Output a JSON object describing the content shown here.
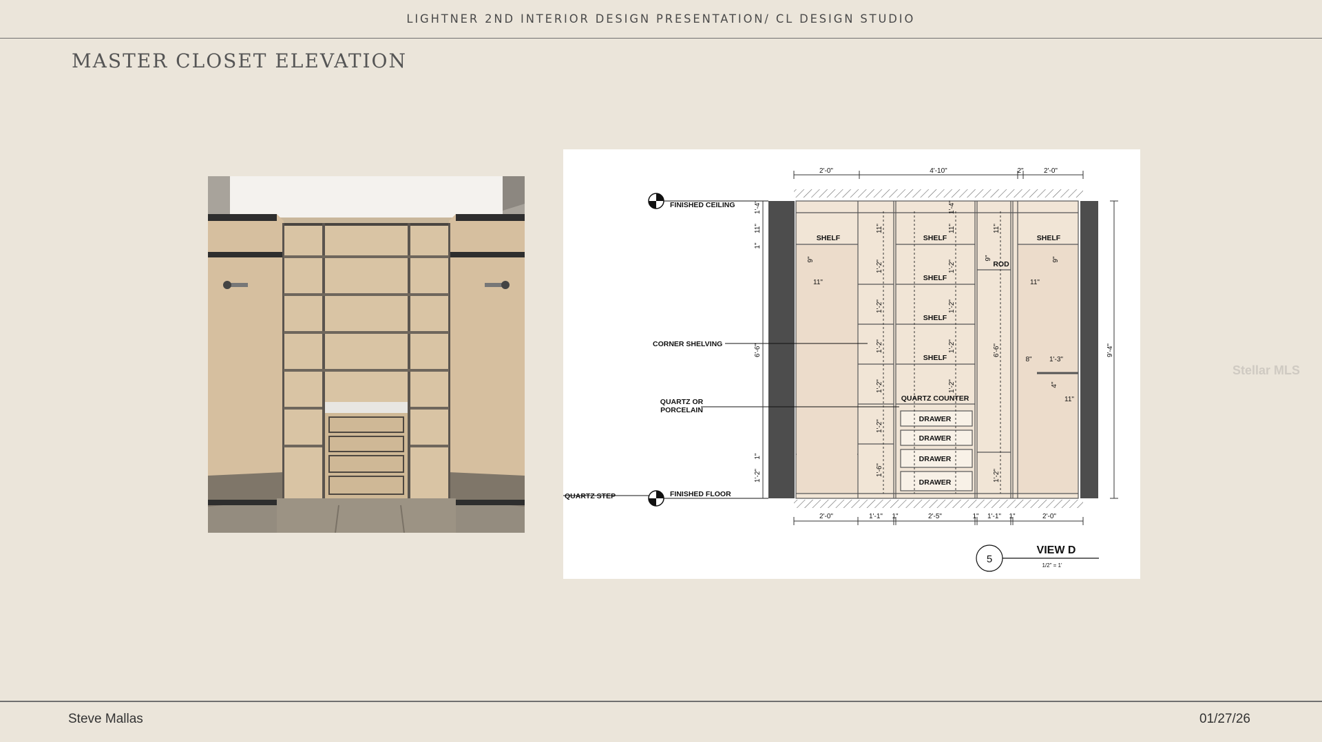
{
  "header": {
    "title": "LIGHTNER 2ND INTERIOR DESIGN PRESENTATION/ CL DESIGN STUDIO"
  },
  "page": {
    "title": "MASTER CLOSET ELEVATION"
  },
  "footer": {
    "author": "Steve Mallas",
    "date": "01/27/26"
  },
  "watermark": "Stellar MLS",
  "drawing": {
    "labels": {
      "finished_ceiling": "FINISHED CEILING",
      "finished_floor": "FINISHED FLOOR",
      "corner_shelving": "CORNER SHELVING",
      "quartz_or": "QUARTZ OR",
      "porcelain": "PORCELAIN",
      "quartz_step": "QUARTZ STEP",
      "quartz_counter": "QUARTZ COUNTER",
      "shelf": "SHELF",
      "rod": "ROD",
      "drawer": "DRAWER",
      "view_number": "5",
      "view_title": "VIEW D",
      "view_scale": "1/2\" = 1'"
    },
    "top_dims": [
      "2'-0\"",
      "4'-10\"",
      "2\"",
      "2'-0\""
    ],
    "bottom_dims": [
      "2'-0\"",
      "1'-1\"",
      "1\"",
      "2'-5\"",
      "1\"",
      "1'-1\"",
      "1\"",
      "2'-0\""
    ],
    "dims": {
      "d_1_4": "1'-4\"",
      "d_11": "11\"",
      "d_1": "1\"",
      "d_6_6": "6'-6\"",
      "d_1_2": "1'-2\"",
      "d_1_6": "1'-6\"",
      "d_9": "9\"",
      "d_9_4": "9'-4\"",
      "d_8": "8\"",
      "d_1_3": "1'-3\"",
      "d_4": "4\"",
      "d_1_1": "1'-1\""
    }
  }
}
